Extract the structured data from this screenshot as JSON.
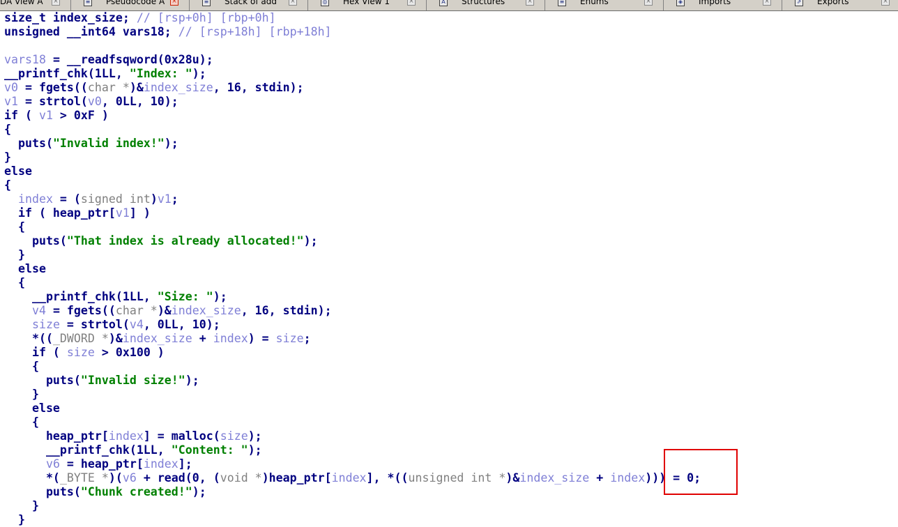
{
  "tabs": [
    {
      "label": "DA View A",
      "icon": "disassembly-view-icon",
      "active": false
    },
    {
      "label": "Pseudocode A",
      "icon": "pseudocode-icon",
      "active": true
    },
    {
      "label": "Stack of add",
      "icon": "stack-icon",
      "active": false
    },
    {
      "label": "Hex View 1",
      "icon": "hex-view-icon",
      "active": false
    },
    {
      "label": "Structures",
      "icon": "structures-icon",
      "active": false
    },
    {
      "label": "Enums",
      "icon": "enums-icon",
      "active": false
    },
    {
      "label": "Imports",
      "icon": "imports-icon",
      "active": false
    },
    {
      "label": "Exports",
      "icon": "exports-icon",
      "active": false
    }
  ],
  "icon_glyphs": {
    "disassembly-view-icon": "≡",
    "pseudocode-icon": "≡",
    "stack-icon": "≡",
    "hex-view-icon": "◎",
    "structures-icon": "A",
    "enums-icon": "≡",
    "imports-icon": "◈",
    "exports-icon": "⇗",
    "close-icon": "×"
  },
  "colors": {
    "keyword": "#000080",
    "variable": "#7f7fd6",
    "string": "#008000",
    "comment": "#7f7fd6",
    "type": "#808080",
    "highlight": "#e00000"
  },
  "code_lines": [
    [
      {
        "t": "size_t index_size; ",
        "c": "kw"
      },
      {
        "t": "// [rsp+0h] [rbp+0h]",
        "c": "cmt"
      }
    ],
    [
      {
        "t": "unsigned __int64 vars18; ",
        "c": "kw"
      },
      {
        "t": "// [rsp+18h] [rbp+18h]",
        "c": "cmt"
      }
    ],
    [],
    [
      {
        "t": "vars18",
        "c": "var"
      },
      {
        "t": " = __readfsqword(0x28u);",
        "c": "kw"
      }
    ],
    [
      {
        "t": "__printf_chk(1LL, ",
        "c": "kw"
      },
      {
        "t": "\"Index: \"",
        "c": "str"
      },
      {
        "t": ");",
        "c": "kw"
      }
    ],
    [
      {
        "t": "v0",
        "c": "var"
      },
      {
        "t": " = fgets((",
        "c": "kw"
      },
      {
        "t": "char *",
        "c": "typ"
      },
      {
        "t": ")&",
        "c": "kw"
      },
      {
        "t": "index_size",
        "c": "var"
      },
      {
        "t": ", 16, stdin);",
        "c": "kw"
      }
    ],
    [
      {
        "t": "v1",
        "c": "var"
      },
      {
        "t": " = strtol(",
        "c": "kw"
      },
      {
        "t": "v0",
        "c": "var"
      },
      {
        "t": ", 0LL, 10);",
        "c": "kw"
      }
    ],
    [
      {
        "t": "if ( ",
        "c": "kw"
      },
      {
        "t": "v1",
        "c": "var"
      },
      {
        "t": " > 0xF )",
        "c": "kw"
      }
    ],
    [
      {
        "t": "{",
        "c": "kw"
      }
    ],
    [
      {
        "t": "  puts(",
        "c": "kw"
      },
      {
        "t": "\"Invalid index!\"",
        "c": "str"
      },
      {
        "t": ");",
        "c": "kw"
      }
    ],
    [
      {
        "t": "}",
        "c": "kw"
      }
    ],
    [
      {
        "t": "else",
        "c": "kw"
      }
    ],
    [
      {
        "t": "{",
        "c": "kw"
      }
    ],
    [
      {
        "t": "  ",
        "c": "kw"
      },
      {
        "t": "index",
        "c": "var"
      },
      {
        "t": " = (",
        "c": "kw"
      },
      {
        "t": "signed int",
        "c": "typ"
      },
      {
        "t": ")",
        "c": "kw"
      },
      {
        "t": "v1",
        "c": "var"
      },
      {
        "t": ";",
        "c": "kw"
      }
    ],
    [
      {
        "t": "  if ( heap_ptr[",
        "c": "kw"
      },
      {
        "t": "v1",
        "c": "var"
      },
      {
        "t": "] )",
        "c": "kw"
      }
    ],
    [
      {
        "t": "  {",
        "c": "kw"
      }
    ],
    [
      {
        "t": "    puts(",
        "c": "kw"
      },
      {
        "t": "\"That index is already allocated!\"",
        "c": "str"
      },
      {
        "t": ");",
        "c": "kw"
      }
    ],
    [
      {
        "t": "  }",
        "c": "kw"
      }
    ],
    [
      {
        "t": "  else",
        "c": "kw"
      }
    ],
    [
      {
        "t": "  {",
        "c": "kw"
      }
    ],
    [
      {
        "t": "    __printf_chk(1LL, ",
        "c": "kw"
      },
      {
        "t": "\"Size: \"",
        "c": "str"
      },
      {
        "t": ");",
        "c": "kw"
      }
    ],
    [
      {
        "t": "    ",
        "c": "kw"
      },
      {
        "t": "v4",
        "c": "var"
      },
      {
        "t": " = fgets((",
        "c": "kw"
      },
      {
        "t": "char *",
        "c": "typ"
      },
      {
        "t": ")&",
        "c": "kw"
      },
      {
        "t": "index_size",
        "c": "var"
      },
      {
        "t": ", 16, stdin);",
        "c": "kw"
      }
    ],
    [
      {
        "t": "    ",
        "c": "kw"
      },
      {
        "t": "size",
        "c": "var"
      },
      {
        "t": " = strtol(",
        "c": "kw"
      },
      {
        "t": "v4",
        "c": "var"
      },
      {
        "t": ", 0LL, 10);",
        "c": "kw"
      }
    ],
    [
      {
        "t": "    *((",
        "c": "kw"
      },
      {
        "t": "_DWORD *",
        "c": "typ"
      },
      {
        "t": ")&",
        "c": "kw"
      },
      {
        "t": "index_size",
        "c": "var"
      },
      {
        "t": " + ",
        "c": "kw"
      },
      {
        "t": "index",
        "c": "var"
      },
      {
        "t": ") = ",
        "c": "kw"
      },
      {
        "t": "size",
        "c": "var"
      },
      {
        "t": ";",
        "c": "kw"
      }
    ],
    [
      {
        "t": "    if ( ",
        "c": "kw"
      },
      {
        "t": "size",
        "c": "var"
      },
      {
        "t": " > 0x100 )",
        "c": "kw"
      }
    ],
    [
      {
        "t": "    {",
        "c": "kw"
      }
    ],
    [
      {
        "t": "      puts(",
        "c": "kw"
      },
      {
        "t": "\"Invalid size!\"",
        "c": "str"
      },
      {
        "t": ");",
        "c": "kw"
      }
    ],
    [
      {
        "t": "    }",
        "c": "kw"
      }
    ],
    [
      {
        "t": "    else",
        "c": "kw"
      }
    ],
    [
      {
        "t": "    {",
        "c": "kw"
      }
    ],
    [
      {
        "t": "      heap_ptr[",
        "c": "kw"
      },
      {
        "t": "index",
        "c": "var"
      },
      {
        "t": "] = malloc(",
        "c": "kw"
      },
      {
        "t": "size",
        "c": "var"
      },
      {
        "t": ");",
        "c": "kw"
      }
    ],
    [
      {
        "t": "      __printf_chk(1LL, ",
        "c": "kw"
      },
      {
        "t": "\"Content: \"",
        "c": "str"
      },
      {
        "t": ");",
        "c": "kw"
      }
    ],
    [
      {
        "t": "      ",
        "c": "kw"
      },
      {
        "t": "v6",
        "c": "var"
      },
      {
        "t": " = heap_ptr[",
        "c": "kw"
      },
      {
        "t": "index",
        "c": "var"
      },
      {
        "t": "];",
        "c": "kw"
      }
    ],
    [
      {
        "t": "      *(",
        "c": "kw"
      },
      {
        "t": "_BYTE *",
        "c": "typ"
      },
      {
        "t": ")(",
        "c": "kw"
      },
      {
        "t": "v6",
        "c": "var"
      },
      {
        "t": " + read(0, (",
        "c": "kw"
      },
      {
        "t": "void *",
        "c": "typ"
      },
      {
        "t": ")heap_ptr[",
        "c": "kw"
      },
      {
        "t": "index",
        "c": "var"
      },
      {
        "t": "], *((",
        "c": "kw"
      },
      {
        "t": "unsigned int *",
        "c": "typ"
      },
      {
        "t": ")&",
        "c": "kw"
      },
      {
        "t": "index_size",
        "c": "var"
      },
      {
        "t": " + ",
        "c": "kw"
      },
      {
        "t": "index",
        "c": "var"
      },
      {
        "t": "))) = 0;",
        "c": "kw"
      }
    ],
    [
      {
        "t": "      puts(",
        "c": "kw"
      },
      {
        "t": "\"Chunk created!\"",
        "c": "str"
      },
      {
        "t": ");",
        "c": "kw"
      }
    ],
    [
      {
        "t": "    }",
        "c": "kw"
      }
    ],
    [
      {
        "t": "  }",
        "c": "kw"
      }
    ]
  ]
}
